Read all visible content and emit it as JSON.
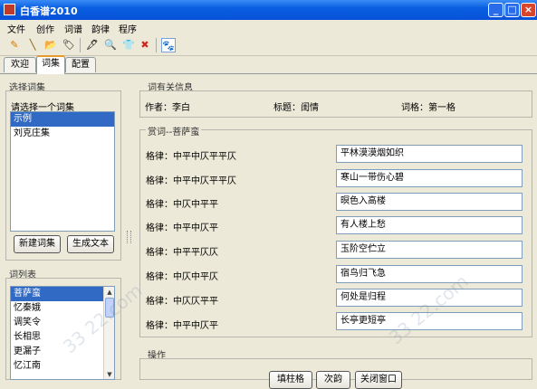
{
  "window": {
    "title": "白香谱2010",
    "minimize": "_",
    "maximize": "□",
    "close": "×"
  },
  "menu": [
    "文件",
    "创作",
    "词谱",
    "韵律",
    "程序"
  ],
  "toolbar": [
    "✎",
    "╲",
    "📂",
    "🏷",
    "🖋",
    "🔍",
    "👕",
    "✖",
    "🐾"
  ],
  "tabs": [
    "欢迎",
    "词集",
    "配置"
  ],
  "left": {
    "collection_group": "选择词集",
    "collection_prompt": "请选择一个词集",
    "collections": [
      "示例",
      "刘克庄集"
    ],
    "new_collection": "新建词集",
    "generate_text": "生成文本",
    "poems_group": "词列表",
    "poems": [
      "菩萨蛮",
      "忆秦娥",
      "调笑令",
      "长相思",
      "更漏子",
      "忆江南"
    ]
  },
  "info": {
    "group": "词有关信息",
    "author": "作者：李白",
    "title": "标题：闺情",
    "format": "词格：第一格"
  },
  "appreciation": {
    "group": "赏词--菩萨蛮",
    "rows": [
      {
        "pattern": "格律：中平中仄平平仄",
        "text": "平林漠漠烟如织"
      },
      {
        "pattern": "格律：中平中仄平平仄",
        "text": "寒山一带伤心碧"
      },
      {
        "pattern": "格律：中仄中平平",
        "text": "暝色入高楼"
      },
      {
        "pattern": "格律：中平中仄平",
        "text": "有人楼上愁"
      },
      {
        "pattern": "格律：中平平仄仄",
        "text": "玉阶空伫立"
      },
      {
        "pattern": "格律：中仄中平仄",
        "text": "宿鸟归飞急"
      },
      {
        "pattern": "格律：中仄仄平平",
        "text": "何处是归程"
      },
      {
        "pattern": "格律：中平中仄平",
        "text": "长亭更短亭"
      }
    ]
  },
  "ops": {
    "group": "操作",
    "buttons": [
      "填柱格",
      "次韵",
      "关闭窗口"
    ]
  },
  "watermark": "33 22.com"
}
